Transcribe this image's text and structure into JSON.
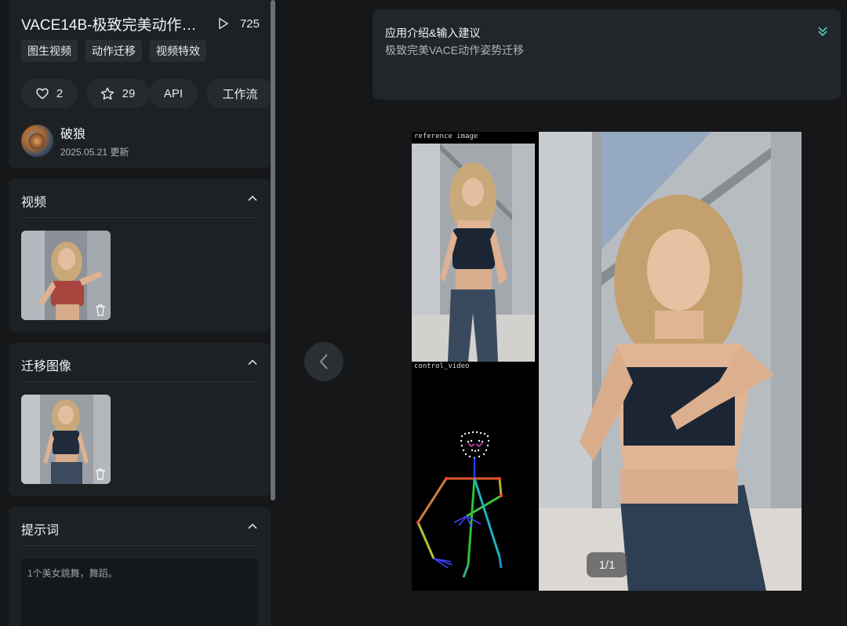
{
  "app": {
    "title": "VACE14B-极致完美动作姿…",
    "view_count": "725",
    "tags": [
      "图生视频",
      "动作迁移",
      "视频特效"
    ],
    "likes": "2",
    "stars": "29",
    "api_label": "API",
    "workflow_label": "工作流",
    "author_name": "破狼",
    "updated": "2025.05.21 更新"
  },
  "sections": {
    "video_title": "视频",
    "image_title": "迁移图像",
    "prompt_title": "提示词",
    "prompt_text": "1个美女跳舞，舞蹈。"
  },
  "intro": {
    "title": "应用介绍&输入建议",
    "subtitle": "极致完美VACE动作姿势迁移"
  },
  "viewer": {
    "ref_label": "reference image",
    "ctrl_label": "control_video",
    "page_indicator": "1/1"
  },
  "colors": {
    "accent": "#4fd1c5",
    "background": "#151719",
    "card": "#1e2124"
  },
  "icons": [
    "play-icon",
    "heart-icon",
    "star-icon",
    "chevron-up-icon",
    "trash-icon",
    "double-chevron-down-icon",
    "chevron-left-icon"
  ]
}
